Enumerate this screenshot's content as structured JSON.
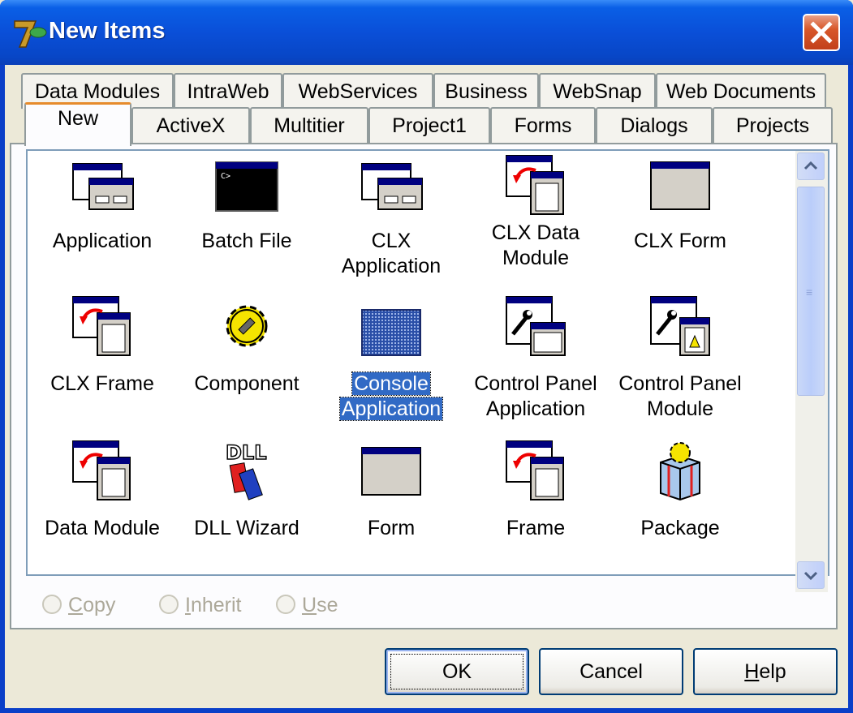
{
  "window": {
    "title": "New Items"
  },
  "tabs": {
    "back_row": [
      "Data Modules",
      "IntraWeb",
      "WebServices",
      "Business",
      "WebSnap",
      "Web Documents"
    ],
    "front_row": [
      "New",
      "ActiveX",
      "Multitier",
      "Project1",
      "Forms",
      "Dialogs",
      "Projects"
    ],
    "active": "New"
  },
  "items": [
    {
      "label_1": "Application",
      "label_2": "",
      "icon": "application-icon"
    },
    {
      "label_1": "Batch File",
      "label_2": "",
      "icon": "batch-file-icon"
    },
    {
      "label_1": "CLX",
      "label_2": "Application",
      "icon": "clx-application-icon"
    },
    {
      "label_1": "CLX Data",
      "label_2": "Module",
      "icon": "clx-data-module-icon"
    },
    {
      "label_1": "CLX Form",
      "label_2": "",
      "icon": "clx-form-icon"
    },
    {
      "label_1": "CLX Frame",
      "label_2": "",
      "icon": "clx-frame-icon"
    },
    {
      "label_1": "Component",
      "label_2": "",
      "icon": "component-gear-icon"
    },
    {
      "label_1": "Console",
      "label_2": "Application",
      "icon": "console-application-icon",
      "selected": true
    },
    {
      "label_1": "Control Panel",
      "label_2": "Application",
      "icon": "control-panel-application-icon"
    },
    {
      "label_1": "Control Panel",
      "label_2": "Module",
      "icon": "control-panel-module-icon"
    },
    {
      "label_1": "Data Module",
      "label_2": "",
      "icon": "data-module-icon"
    },
    {
      "label_1": "DLL Wizard",
      "label_2": "",
      "icon": "dll-wizard-icon"
    },
    {
      "label_1": "Form",
      "label_2": "",
      "icon": "form-icon"
    },
    {
      "label_1": "Frame",
      "label_2": "",
      "icon": "frame-icon"
    },
    {
      "label_1": "Package",
      "label_2": "",
      "icon": "package-icon"
    }
  ],
  "options": {
    "copy": {
      "prefix": "C",
      "rest": "opy"
    },
    "inherit": {
      "prefix": "I",
      "rest": "nherit"
    },
    "use": {
      "prefix": "U",
      "rest": "se"
    }
  },
  "buttons": {
    "ok": "OK",
    "cancel": "Cancel",
    "help_prefix": "H",
    "help_rest": "elp"
  }
}
